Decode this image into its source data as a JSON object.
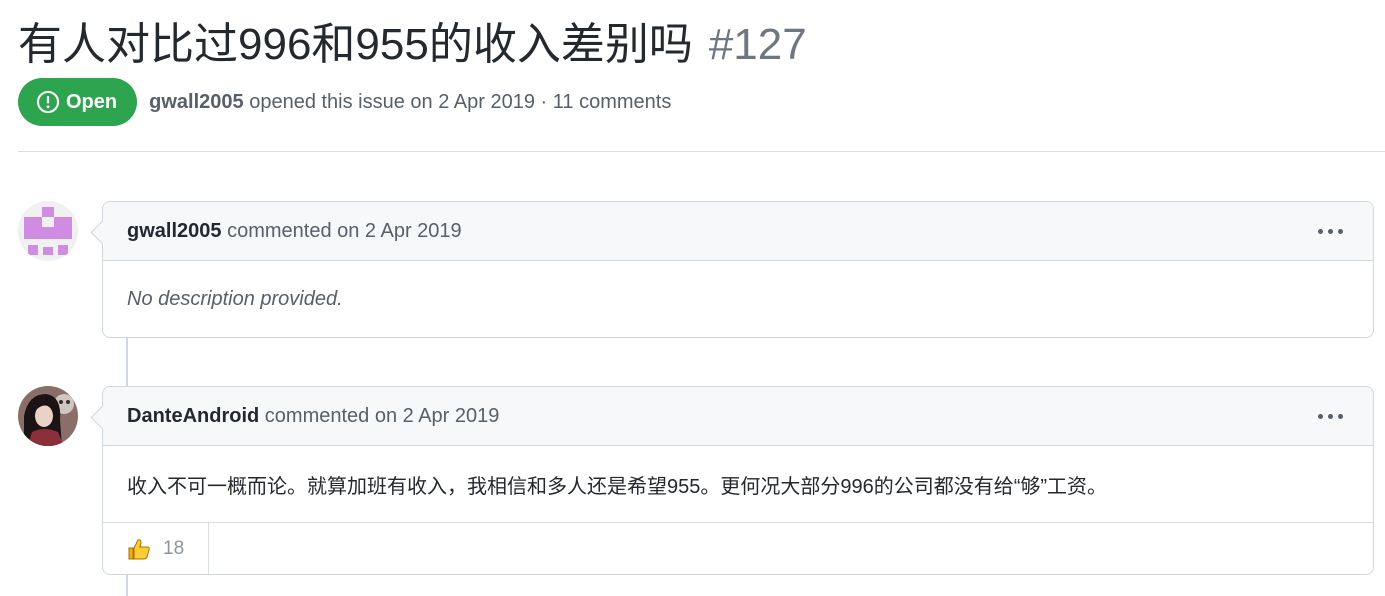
{
  "issue": {
    "title": "有人对比过996和955的收入差别吗",
    "number": "#127",
    "state": "Open",
    "state_color": "#2da44e",
    "author": "gwall2005",
    "meta_text": "opened this issue on 2 Apr 2019 · 11 comments"
  },
  "comments": [
    {
      "author": "gwall2005",
      "action": "commented on 2 Apr 2019",
      "body": "No description provided.",
      "avatar_icon": "identicon-avatar",
      "avatar_color": "#d08ce0"
    },
    {
      "author": "DanteAndroid",
      "action": "commented on 2 Apr 2019",
      "body": "收入不可一概而论。就算加班有收入，我相信和多人还是希望955。更何况大部分996的公司都没有给“够”工资。",
      "avatar_icon": "user-photo-avatar",
      "reactions": [
        {
          "icon": "thumbs-up-icon",
          "count": "18"
        }
      ]
    }
  ]
}
